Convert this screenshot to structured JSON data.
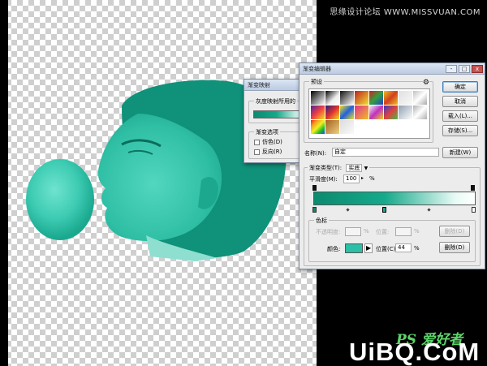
{
  "watermark_top": "思缘设计论坛 WWW.MISSVUAN.COM",
  "watermark_bottom": {
    "ps": "PS 爱好者",
    "site": "UiBQ.CoM"
  },
  "gradient_map_dialog": {
    "title": "渐变映射",
    "group1_title": "灰度映射所用的",
    "group2_title": "渐变选项",
    "option_dither": "仿色(D)",
    "option_reverse": "反向(R)"
  },
  "gradient_editor": {
    "title": "渐变编辑器",
    "window_buttons": {
      "minimize": "-",
      "maximize": "□",
      "close": "x"
    },
    "presets_title": "预设",
    "presets_menu_icon": "gear-icon",
    "buttons": {
      "ok": "确定",
      "cancel": "取消",
      "load": "载入(L)...",
      "save": "存储(S)...",
      "new": "新建(W)"
    },
    "name_label": "名称(N):",
    "name_value": "自定",
    "gradient_type_label": "渐变类型(T):",
    "gradient_type_value": "实底",
    "smoothness_label": "平滑度(M):",
    "smoothness_value": "100",
    "smoothness_unit": "%",
    "color_stops_title": "色标",
    "opacity_label": "不透明度:",
    "opacity_unit": "%",
    "location_label": "位置:",
    "color_label": "颜色:",
    "color_location_label": "位置(C):",
    "color_location_value": "44",
    "location_unit": "%",
    "delete_label": "删除(D)",
    "gradient_colors": [
      "#0c8a6f",
      "#16a98b",
      "#e8fbf6",
      "#ffffff"
    ],
    "selected_color": "#2bbfa6"
  },
  "colors": {
    "teal_dark": "#0f8f78",
    "teal_mid": "#2cc0a6",
    "teal_light": "#58d9c2"
  }
}
